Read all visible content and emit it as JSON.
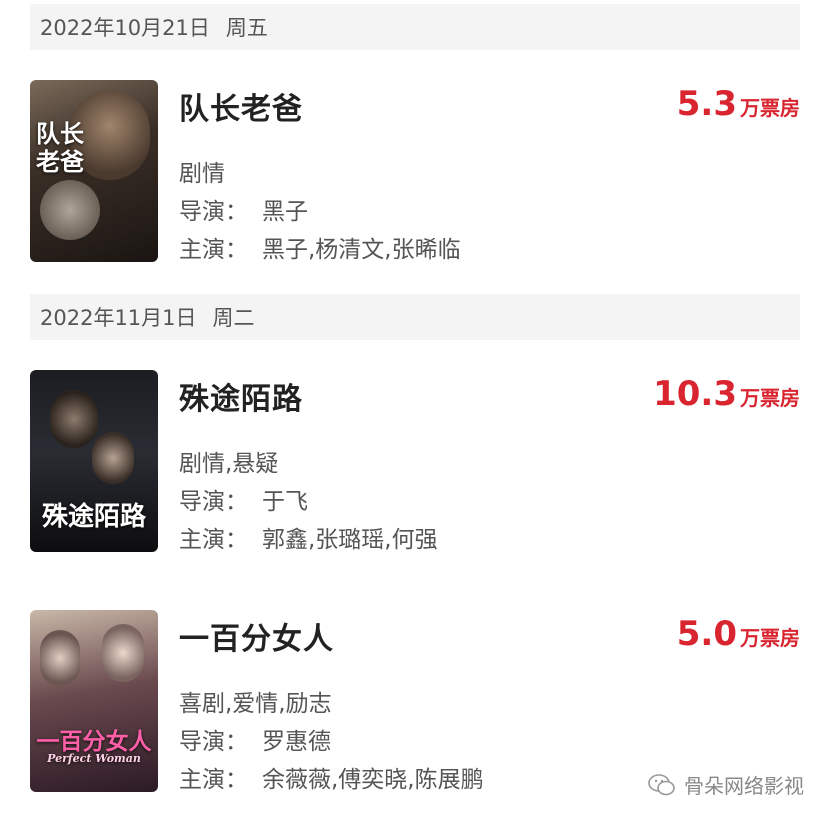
{
  "sections": [
    {
      "date": "2022年10月21日",
      "weekday": "周五",
      "movie": {
        "poster_text": "队长老爸",
        "title": "队长老爸",
        "box_value": "5.3",
        "box_unit": "万票房",
        "genre": "剧情",
        "director_label": "导演：",
        "director": "黑子",
        "cast_label": "主演：",
        "cast": "黑子,杨清文,张晞临"
      }
    },
    {
      "date": "2022年11月1日",
      "weekday": "周二",
      "movie": {
        "poster_text": "殊途陌路",
        "title": "殊途陌路",
        "box_value": "10.3",
        "box_unit": "万票房",
        "genre": "剧情,悬疑",
        "director_label": "导演：",
        "director": "于飞",
        "cast_label": "主演：",
        "cast": "郭鑫,张璐瑶,何强"
      }
    }
  ],
  "extra_movie": {
    "poster_text": "一百分女人",
    "poster_subtext": "Perfect Woman",
    "title": "一百分女人",
    "box_value": "5.0",
    "box_unit": "万票房",
    "genre": "喜剧,爱情,励志",
    "director_label": "导演：",
    "director": "罗惠德",
    "cast_label": "主演：",
    "cast": "余薇薇,傅奕晓,陈展鹏"
  },
  "watermark": {
    "text": "骨朵网络影视",
    "icon": "wechat-icon"
  },
  "colors": {
    "accent": "#d9252f",
    "date_bg": "#f4f4f4"
  }
}
